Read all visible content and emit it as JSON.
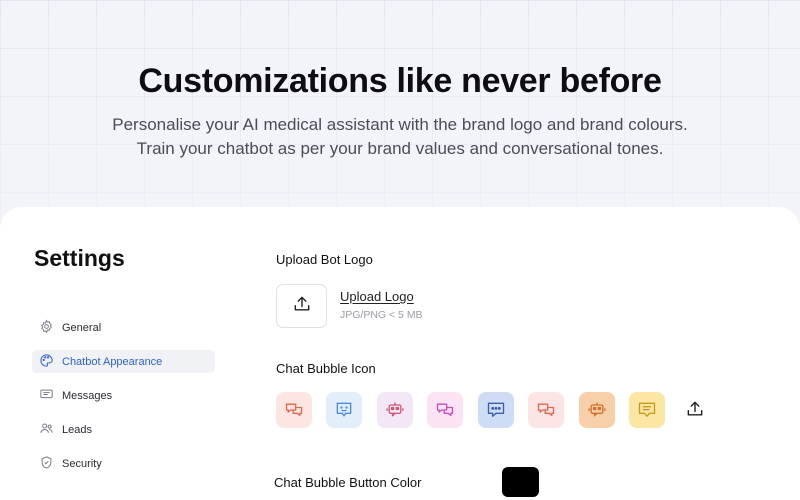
{
  "hero": {
    "title": "Customizations like never before",
    "line1": "Personalise your AI medical assistant with the brand logo and brand colours.",
    "line2": "Train your chatbot as per your brand values and conversational tones."
  },
  "settings": {
    "title": "Settings",
    "nav": [
      {
        "label": "General",
        "icon": "gear-icon",
        "active": false
      },
      {
        "label": "Chatbot Appearance",
        "icon": "palette-icon",
        "active": true
      },
      {
        "label": "Messages",
        "icon": "message-icon",
        "active": false
      },
      {
        "label": "Leads",
        "icon": "users-icon",
        "active": false
      },
      {
        "label": "Security",
        "icon": "shield-icon",
        "active": false
      }
    ]
  },
  "upload_logo": {
    "section_title": "Upload Bot Logo",
    "link_label": "Upload Logo",
    "hint": "JPG/PNG < 5 MB"
  },
  "chat_bubble_icon": {
    "section_title": "Chat Bubble Icon",
    "options": [
      {
        "icon": "chat-dual-icon",
        "bg": "#fde6e1",
        "fg": "#e0674f"
      },
      {
        "icon": "chat-smile-icon",
        "bg": "#e3eefb",
        "fg": "#4d8ad6"
      },
      {
        "icon": "chat-bot-icon",
        "bg": "#f3e6f6",
        "fg": "#d2566f"
      },
      {
        "icon": "chat-dual-icon",
        "bg": "#fbe3f4",
        "fg": "#c34fb6"
      },
      {
        "icon": "chat-dots-icon",
        "bg": "#cfdcf6",
        "fg": "#3d5fa8"
      },
      {
        "icon": "chat-dual-icon",
        "bg": "#fde4e4",
        "fg": "#e0674f"
      },
      {
        "icon": "chat-bot-icon",
        "bg": "#f9cfa9",
        "fg": "#d56f2c"
      },
      {
        "icon": "chat-lines-icon",
        "bg": "#fbe6a4",
        "fg": "#c69a1f"
      }
    ]
  },
  "chat_bubble_color": {
    "section_title": "Chat Bubble Button Color",
    "value": "#000000"
  },
  "colors": {
    "accent": "#2f62c9",
    "active_nav_bg": "#f1f2f6"
  }
}
